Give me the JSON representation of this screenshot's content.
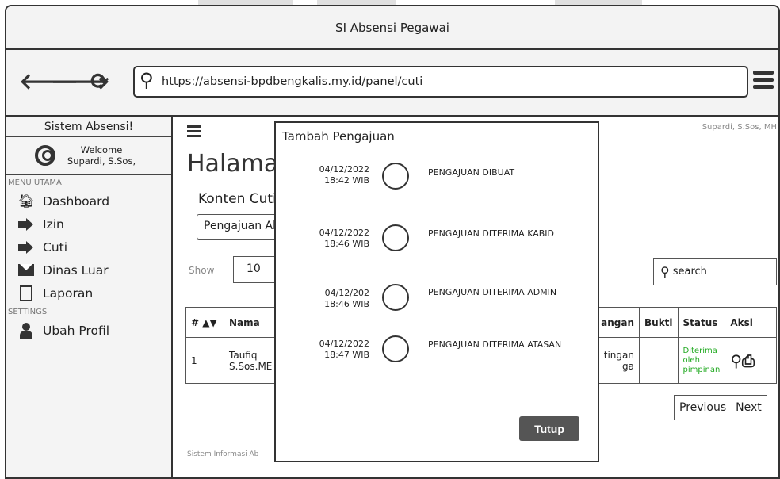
{
  "window": {
    "title": "SI Absensi Pegawai"
  },
  "browser": {
    "url": "https://absensi-bpdbengkalis.my.id/panel/cuti"
  },
  "sidebar": {
    "header": "Sistem Absensi!",
    "welcome_line1": "Welcome",
    "welcome_line2": "Supardi, S.Sos,",
    "section_main": "MENU UTAMA",
    "items": [
      {
        "label": "Dashboard",
        "icon": "home-icon"
      },
      {
        "label": "Izin",
        "icon": "sign-in-icon"
      },
      {
        "label": "Cuti",
        "icon": "sign-in-icon"
      },
      {
        "label": "Dinas Luar",
        "icon": "envelope-icon"
      },
      {
        "label": "Laporan",
        "icon": "pdf-icon"
      }
    ],
    "section_settings": "SETTINGS",
    "settings_items": [
      {
        "label": "Ubah Profil",
        "icon": "user-icon"
      }
    ]
  },
  "main": {
    "user_name": "Supardi, S.Sos, MH",
    "page_title": "Halaman",
    "section_title": "Konten Cuti",
    "select_value": "Pengajuan Ak",
    "show_label": "Show",
    "show_value": "10",
    "search_placeholder": "search",
    "table": {
      "headers": [
        "#",
        "Nama",
        "angan",
        "Bukti",
        "Status",
        "Aksi"
      ],
      "rows": [
        {
          "no": "1",
          "nama_line1": "Taufiq",
          "nama_line2": "S.Sos.ME",
          "ket_line1": "tingan",
          "ket_line2": "ga",
          "bukti": "",
          "status_line1": "Diterima",
          "status_line2": "oleh",
          "status_line3": "pimpinan"
        }
      ]
    },
    "pager": {
      "prev": "Previous",
      "next": "Next"
    },
    "footer": "Sistem Informasi Ab"
  },
  "modal": {
    "title": "Tambah Pengajuan",
    "timeline": [
      {
        "date": "04/12/2022",
        "time": "18:42 WIB",
        "label": "PENGAJUAN DIBUAT"
      },
      {
        "date": "04/12/2022",
        "time": "18:46 WIB",
        "label": "PENGAJUAN DITERIMA KABID"
      },
      {
        "date": "04/12/202",
        "time": "18:46 WIB",
        "label": "PENGAJUAN DITERIMA ADMIN"
      },
      {
        "date": "04/12/2022",
        "time": "18:47 WIB",
        "label": "PENGAJUAN DITERIMA ATASAN"
      }
    ],
    "close_label": "Tutup"
  },
  "colors": {
    "status_green": "#22aa22",
    "button_grey": "#555555"
  }
}
